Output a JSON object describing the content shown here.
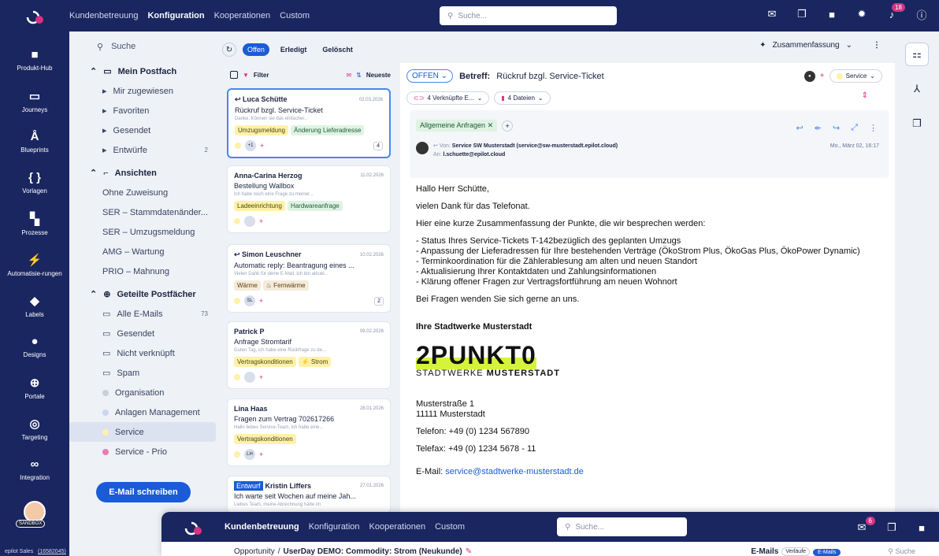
{
  "topbar": {
    "nav": [
      "Kundenbetreuung",
      "Konfiguration",
      "Kooperationen",
      "Custom"
    ],
    "active_index": 1,
    "search_placeholder": "Suche...",
    "notif_count": "18"
  },
  "rail": {
    "items": [
      {
        "label": "Produkt-Hub",
        "icon": "box-icon",
        "glyph": "■"
      },
      {
        "label": "Journeys",
        "icon": "journey-icon",
        "glyph": "▭"
      },
      {
        "label": "Blueprints",
        "icon": "blueprint-icon",
        "glyph": "Å"
      },
      {
        "label": "Vorlagen",
        "icon": "braces-icon",
        "glyph": "{ }"
      },
      {
        "label": "Prozesse",
        "icon": "process-icon",
        "glyph": "▚"
      },
      {
        "label": "Automatisie-rungen",
        "icon": "bolt-icon",
        "glyph": "⚡"
      },
      {
        "label": "Labels",
        "icon": "label-icon",
        "glyph": "◆"
      },
      {
        "label": "Designs",
        "icon": "palette-icon",
        "glyph": "●"
      },
      {
        "label": "Portale",
        "icon": "globe-icon",
        "glyph": "⊕"
      },
      {
        "label": "Targeting",
        "icon": "target-icon",
        "glyph": "◎"
      },
      {
        "label": "Integration",
        "icon": "integration-icon",
        "glyph": "∞"
      }
    ],
    "sandbox": "SANDBOX",
    "footer": "epilot Sales",
    "footer_id": "(16582045)"
  },
  "sidebar": {
    "search": "Suche",
    "mailbox_title": "Mein Postfach",
    "mailbox_items": [
      {
        "label": "Mir zugewiesen",
        "icon": "assign-icon"
      },
      {
        "label": "Favoriten",
        "icon": "star-icon"
      },
      {
        "label": "Gesendet",
        "icon": "send-icon"
      },
      {
        "label": "Entwürfe",
        "icon": "draft-icon",
        "count": "2"
      }
    ],
    "views_title": "Ansichten",
    "views": [
      "Ohne Zuweisung",
      "SER – Stammdatenänder...",
      "SER – Umzugsmeldung",
      "AMG – Wartung",
      "PRIO – Mahnung"
    ],
    "shared_title": "Geteilte Postfächer",
    "shared_items": [
      {
        "label": "Alle E-Mails",
        "icon": "mail-icon",
        "count": "73"
      },
      {
        "label": "Gesendet",
        "icon": "send-icon"
      },
      {
        "label": "Nicht verknüpft",
        "icon": "unlink-icon"
      },
      {
        "label": "Spam",
        "icon": "spam-icon"
      }
    ],
    "groups": [
      {
        "label": "Organisation",
        "color": "#c9ced9"
      },
      {
        "label": "Anlagen Management",
        "color": "#c9d6f2"
      },
      {
        "label": "Service",
        "color": "#fff2a8"
      },
      {
        "label": "Service - Prio",
        "color": "#e87bb0"
      }
    ],
    "write_button": "E-Mail schreiben"
  },
  "list": {
    "filters": [
      "Offen",
      "Erledigt",
      "Gelöscht"
    ],
    "filter_label": "Filter",
    "sort_label": "Neueste",
    "cards": [
      {
        "name": "Luca Schütte",
        "date": "02.03.2026",
        "subject": "Rückruf bzgl. Service-Ticket",
        "preview": "Danke. Können sie das einfacher...",
        "tags": [
          {
            "t": "Umzugsmeldung",
            "c": "y"
          },
          {
            "t": "Änderung Lieferadresse",
            "c": "g"
          }
        ],
        "avatar": "+1",
        "count": "4",
        "reply": true
      },
      {
        "name": "Anna-Carina Herzog",
        "date": "11.02.2026",
        "subject": "Bestellung Wallbox",
        "preview": "Ich habe noch eine Frage zu meiner...",
        "tags": [
          {
            "t": "Ladeeinrichtung",
            "c": "y"
          },
          {
            "t": "Hardwareanfrage",
            "c": "g"
          }
        ],
        "avatar": "",
        "count": ""
      },
      {
        "name": "Simon Leuschner",
        "date": "10.02.2026",
        "subject": "Automatic reply: Beantragung eines ...",
        "preview": "Vielen Dank für deine E-Mail, Ich bin aktuel...",
        "tags": [
          {
            "t": "Wärme",
            "c": "o"
          },
          {
            "t": "♨ Fernwärme",
            "c": "o"
          }
        ],
        "avatar": "SL",
        "count": "2",
        "reply": true
      },
      {
        "name": "Patrick P",
        "date": "09.02.2026",
        "subject": "Anfrage Stromtarif",
        "preview": "Guten Tag, ich habe eine Rückfrage zu de...",
        "tags": [
          {
            "t": "Vertragskonditionen",
            "c": "y"
          },
          {
            "t": "⚡ Strom",
            "c": "y"
          }
        ],
        "avatar": "",
        "count": ""
      },
      {
        "name": "Lina Haas",
        "date": "28.01.2026",
        "subject": "Fragen zum Vertrag 702617266",
        "preview": "Hallo liebes Service-Team, ich habe eine...",
        "tags": [
          {
            "t": "Vertragskonditionen",
            "c": "y"
          }
        ],
        "avatar": "LH",
        "count": ""
      },
      {
        "name": "Kristin Liffers",
        "date": "27.01.2026",
        "subject": "Ich warte seit Wochen auf meine Jah...",
        "preview": "Liebes Team, meine Abrechnung hätte im",
        "tags": [],
        "avatar": "",
        "count": "",
        "draft": "Entwurf"
      }
    ]
  },
  "detail": {
    "summary": "Zusammenfassung",
    "status": "OFFEN",
    "subject_label": "Betreff:",
    "subject": "Rückruf bzgl. Service-Ticket",
    "service": "Service",
    "linked": "4 Verknüpfte E...",
    "files": "4 Dateien",
    "category": "Allgemeine Anfragen",
    "from_label": "Von:",
    "from": "Service SW Musterstadt (service@sw-musterstadt.epilot.cloud)",
    "to_label": "An:",
    "to": "l.schuette@epilot.cloud",
    "date": "Mo., März 02, 16:17",
    "greeting": "Hallo Herr Schütte,",
    "p1": "vielen Dank für das Telefonat.",
    "p2": "Hier eine kurze Zusammenfassung der Punkte, die wir besprechen werden:",
    "bullets": [
      "- Status Ihres Service-Tickets T-142bezüglich des geplanten Umzugs",
      "- Anpassung der Lieferadressen für Ihre bestehenden Verträge (ÖkoStrom Plus, ÖkoGas Plus, ÖkoPower Dynamic)",
      "- Terminkoordination für die Zählerablesung am alten und neuen Standort",
      "- Aktualisierung Ihrer Kontaktdaten und Zahlungsinformationen",
      "- Klärung offener Fragen zur Vertragsfortführung am neuen Wohnort"
    ],
    "p3": "Bei Fragen wenden Sie sich gerne an uns.",
    "signature": "Ihre Stadtwerke Musterstadt",
    "logo_main": "2PUNKT0",
    "logo_sub_a": "STADTWERKE ",
    "logo_sub_b": "MUSTERSTADT",
    "street": "Musterstraße 1",
    "city": "11111 Musterstadt",
    "phone": "Telefon: +49 (0) 1234 567890",
    "fax": "Telefax: +49 (0) 1234 5678 - 11",
    "email_label": "E-Mail: ",
    "email": "service@stadtwerke-musterstadt.de"
  },
  "overlay": {
    "nav": [
      "Kundenbetreuung",
      "Konfiguration",
      "Kooperationen",
      "Custom"
    ],
    "search_placeholder": "Suche...",
    "mail_badge": "6",
    "breadcrumb_a": "Opportunity",
    "breadcrumb_sep": "/",
    "breadcrumb_b": "UserDay DEMO: Commodity: Strom (Neukunde)",
    "emails_label": "E-Mails",
    "verlaeufe": "Verläufe",
    "emails_tab": "E-Mails",
    "search": "Suche"
  }
}
